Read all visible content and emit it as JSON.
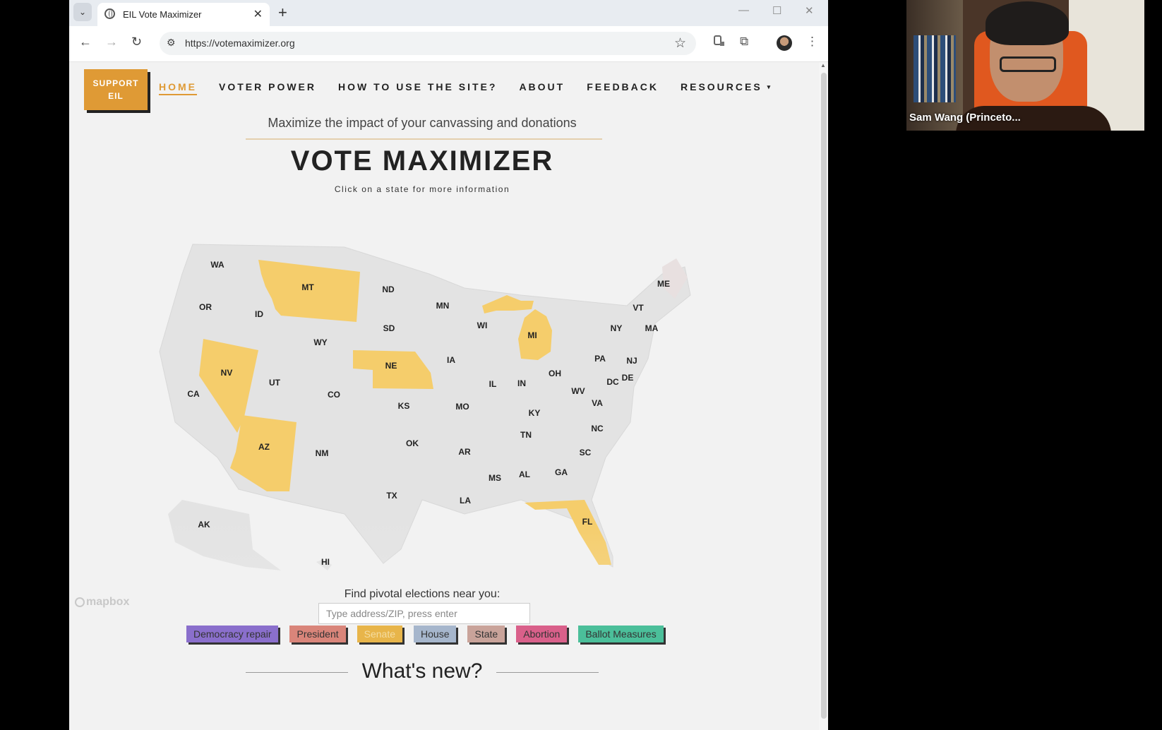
{
  "browser": {
    "tab_title": "EIL Vote Maximizer",
    "url": "https://votemaximizer.org",
    "glyphs": {
      "tab_list": "⌄",
      "close": "✕",
      "new_tab": "+",
      "minimize": "—",
      "maximize": "☐",
      "window_close": "✕",
      "back": "←",
      "forward": "→",
      "reload": "↻",
      "site_info": "⚙",
      "star": "☆",
      "puzzle": "⧉",
      "menu": "⋮",
      "scroll_up": "▲"
    }
  },
  "page": {
    "support_label": "SUPPORT EIL",
    "nav": [
      {
        "label": "HOME"
      },
      {
        "label": "VOTER POWER"
      },
      {
        "label": "HOW TO USE THE SITE?"
      },
      {
        "label": "ABOUT"
      },
      {
        "label": "FEEDBACK"
      },
      {
        "label": "RESOURCES",
        "caret": "▾"
      }
    ],
    "tagline": "Maximize the impact of your canvassing and donations",
    "title": "VOTE MAXIMIZER",
    "subtitle": "Click on a state for more information",
    "map_logo": "mapbox",
    "find_label": "Find pivotal elections near you:",
    "search_placeholder": "Type address/ZIP, press enter",
    "filters": [
      {
        "label": "Democracy repair",
        "color": "#8a6fcc"
      },
      {
        "label": "President",
        "color": "#d9857a"
      },
      {
        "label": "Senate",
        "color": "#e8b54a"
      },
      {
        "label": "House",
        "color": "#a6b6cc"
      },
      {
        "label": "State",
        "color": "#c9a39a"
      },
      {
        "label": "Abortion",
        "color": "#d9608a"
      },
      {
        "label": "Ballot Measures",
        "color": "#4bbf9a"
      }
    ],
    "whats_new": "What's new?",
    "colors": {
      "accent": "#df9a35",
      "highlight_state": "#f5cd6b",
      "state_default": "#e3e3e3"
    },
    "highlighted_states": [
      "MT",
      "NV",
      "AZ",
      "NE",
      "MI",
      "FL"
    ],
    "state_labels": [
      "WA",
      "OR",
      "CA",
      "ID",
      "NV",
      "MT",
      "WY",
      "UT",
      "AZ",
      "CO",
      "NM",
      "ND",
      "SD",
      "NE",
      "KS",
      "OK",
      "TX",
      "MN",
      "IA",
      "MO",
      "AR",
      "LA",
      "WI",
      "IL",
      "MS",
      "MI",
      "IN",
      "KY",
      "TN",
      "AL",
      "OH",
      "GA",
      "FL",
      "SC",
      "NC",
      "VA",
      "WV",
      "PA",
      "NY",
      "NJ",
      "DE",
      "DC",
      "VT",
      "MA",
      "ME",
      "AK",
      "HI"
    ]
  },
  "video": {
    "participant_name": "Sam Wang (Princeto..."
  }
}
